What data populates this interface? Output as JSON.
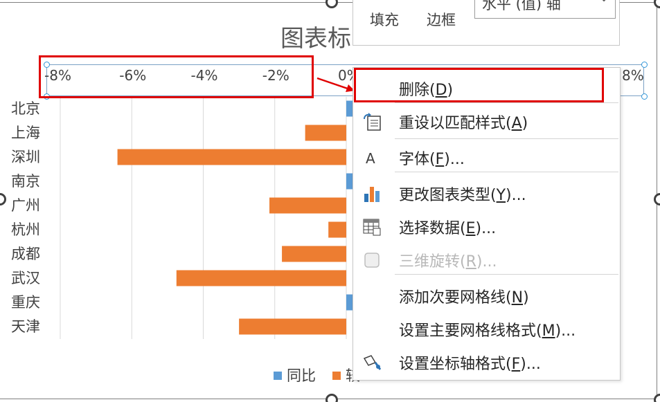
{
  "chart_data": {
    "type": "bar",
    "orientation": "horizontal",
    "title": "图表标",
    "categories": [
      "北京",
      "上海",
      "深圳",
      "南京",
      "广州",
      "杭州",
      "成都",
      "武汉",
      "重庆",
      "天津"
    ],
    "series": [
      {
        "name": "同比",
        "color": "#5b9bd5",
        "values": [
          0.2,
          null,
          null,
          0.2,
          null,
          null,
          null,
          null,
          0.2,
          null
        ]
      },
      {
        "name": "较",
        "color": "#ed7d31",
        "values": [
          null,
          -1.15,
          -6.4,
          null,
          -2.15,
          -0.5,
          -1.8,
          -4.75,
          null,
          -3.0
        ]
      }
    ],
    "x_ticks": [
      "-8%",
      "-6%",
      "-4%",
      "-2%",
      "0%",
      "8%"
    ],
    "xlim": [
      -8,
      8
    ],
    "grid": true,
    "legend_position": "bottom"
  },
  "format_popup": {
    "fill_label": "填充",
    "border_label": "边框",
    "selected_element": "水平 (值) 轴"
  },
  "context_menu": {
    "items": [
      {
        "label": "删除(",
        "key": "D",
        "tail": ")",
        "icon": "none",
        "disabled": false
      },
      {
        "label": "重设以匹配样式(",
        "key": "A",
        "tail": ")",
        "icon": "reset-style-icon",
        "disabled": false
      },
      {
        "label": "字体(",
        "key": "F",
        "tail": ")...",
        "icon": "font-icon",
        "disabled": false
      },
      {
        "label": "更改图表类型(",
        "key": "Y",
        "tail": ")...",
        "icon": "change-chart-type-icon",
        "disabled": false
      },
      {
        "label": "选择数据(",
        "key": "E",
        "tail": ")...",
        "icon": "select-data-icon",
        "disabled": false
      },
      {
        "label": "三维旋转(",
        "key": "R",
        "tail": ")...",
        "icon": "3d-rotation-icon",
        "disabled": true
      },
      {
        "label": "添加次要网格线(",
        "key": "N",
        "tail": ")",
        "icon": "none",
        "disabled": false
      },
      {
        "label": "设置主要网格线格式(",
        "key": "M",
        "tail": ")...",
        "icon": "none",
        "disabled": false
      },
      {
        "label": "设置坐标轴格式(",
        "key": "F",
        "tail": ")...",
        "icon": "format-axis-icon",
        "disabled": false
      }
    ]
  },
  "colors": {
    "highlight": "#e00000",
    "series_blue": "#5b9bd5",
    "series_orange": "#ed7d31"
  }
}
